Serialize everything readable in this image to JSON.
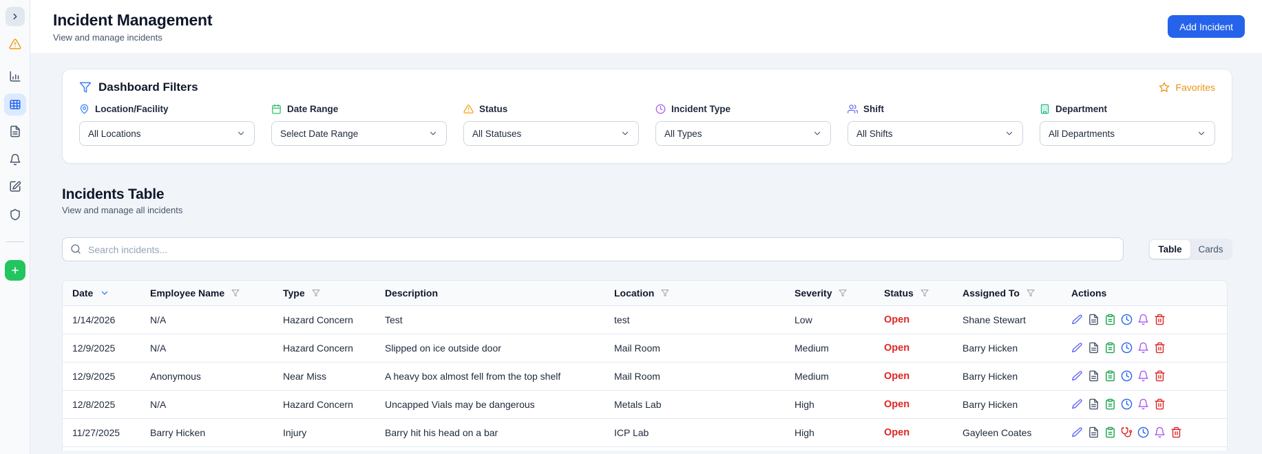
{
  "header": {
    "title": "Incident Management",
    "subtitle": "View and manage incidents",
    "add_incident_button": "Add Incident"
  },
  "sidebar": {
    "icons": [
      "chevron-right",
      "alert-triangle",
      "bar-chart",
      "table",
      "document",
      "bell",
      "edit-square",
      "shield",
      "plus"
    ],
    "active_icon": "table"
  },
  "filters": {
    "title": "Dashboard Filters",
    "favorites_label": "Favorites",
    "fields": [
      {
        "label": "Location/Facility",
        "value": "All Locations",
        "icon": "map-pin"
      },
      {
        "label": "Date Range",
        "value": "Select Date Range",
        "icon": "calendar"
      },
      {
        "label": "Status",
        "value": "All Statuses",
        "icon": "alert-triangle"
      },
      {
        "label": "Incident Type",
        "value": "All Types",
        "icon": "clock"
      },
      {
        "label": "Shift",
        "value": "All Shifts",
        "icon": "users"
      },
      {
        "label": "Department",
        "value": "All Departments",
        "icon": "building"
      }
    ]
  },
  "incidents": {
    "title": "Incidents Table",
    "subtitle": "View and manage all incidents",
    "search_placeholder": "Search incidents...",
    "view_toggle": {
      "table": "Table",
      "cards": "Cards",
      "active": "Table"
    }
  },
  "table": {
    "columns": [
      {
        "label": "Date",
        "control": "sort-desc"
      },
      {
        "label": "Employee Name",
        "control": "filter"
      },
      {
        "label": "Type",
        "control": "filter"
      },
      {
        "label": "Description",
        "control": "none"
      },
      {
        "label": "Location",
        "control": "filter"
      },
      {
        "label": "Severity",
        "control": "filter"
      },
      {
        "label": "Status",
        "control": "filter"
      },
      {
        "label": "Assigned To",
        "control": "filter"
      },
      {
        "label": "Actions",
        "control": "none"
      }
    ],
    "rows": [
      {
        "date": "1/14/2026",
        "employee": "N/A",
        "type": "Hazard Concern",
        "description": "Test",
        "location": "test",
        "severity": "Low",
        "status": "Open",
        "assigned": "Shane Stewart",
        "actions": [
          "edit",
          "document",
          "clipboard",
          "clock",
          "bell",
          "trash"
        ]
      },
      {
        "date": "12/9/2025",
        "employee": "N/A",
        "type": "Hazard Concern",
        "description": "Slipped on ice outside door",
        "location": "Mail Room",
        "severity": "Medium",
        "status": "Open",
        "assigned": "Barry Hicken",
        "actions": [
          "edit",
          "document",
          "clipboard",
          "clock",
          "bell",
          "trash"
        ]
      },
      {
        "date": "12/9/2025",
        "employee": "Anonymous",
        "type": "Near Miss",
        "description": "A heavy box almost fell from the top shelf",
        "location": "Mail Room",
        "severity": "Medium",
        "status": "Open",
        "assigned": "Barry Hicken",
        "actions": [
          "edit",
          "document",
          "clipboard",
          "clock",
          "bell",
          "trash"
        ]
      },
      {
        "date": "12/8/2025",
        "employee": "N/A",
        "type": "Hazard Concern",
        "description": "Uncapped Vials may be dangerous",
        "location": "Metals Lab",
        "severity": "High",
        "status": "Open",
        "assigned": "Barry Hicken",
        "actions": [
          "edit",
          "document",
          "clipboard",
          "clock",
          "bell",
          "trash"
        ]
      },
      {
        "date": "11/27/2025",
        "employee": "Barry Hicken",
        "type": "Injury",
        "description": "Barry hit his head on a bar",
        "location": "ICP Lab",
        "severity": "High",
        "status": "Open",
        "assigned": "Gayleen Coates",
        "actions": [
          "edit",
          "document",
          "clipboard",
          "stethoscope",
          "clock",
          "bell",
          "trash"
        ]
      }
    ]
  },
  "colors": {
    "accent_blue": "#2563eb",
    "status_open_red": "#dc2626",
    "favorites_orange": "#ea9414",
    "sidebar_active_bg": "#dbeafe",
    "add_new_green": "#22c55e",
    "page_background": "#f1f5f9"
  }
}
